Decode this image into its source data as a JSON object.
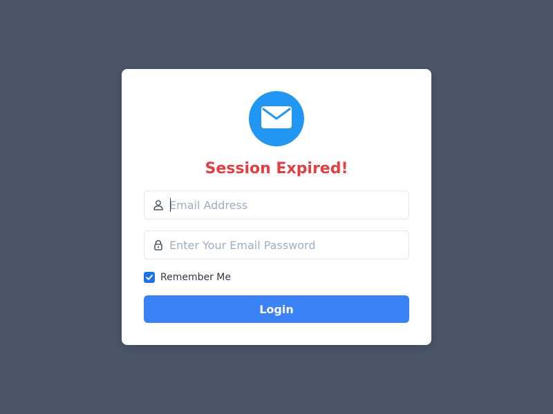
{
  "card": {
    "title": "Session Expired!",
    "logo_icon": "envelope-icon"
  },
  "form": {
    "email": {
      "icon": "user-icon",
      "value": "",
      "placeholder": "Email Address"
    },
    "password": {
      "icon": "lock-icon",
      "value": "",
      "placeholder": "Enter Your Email Password"
    },
    "remember": {
      "label": "Remember Me",
      "checked": true
    },
    "submit_label": "Login"
  },
  "colors": {
    "background": "#4a5568",
    "accent": "#3b82f6",
    "logo": "#2196f3",
    "title": "#e53e3e"
  }
}
